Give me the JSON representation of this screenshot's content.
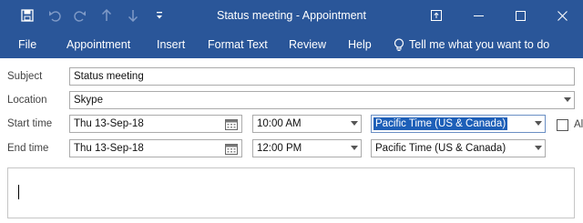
{
  "window": {
    "title": "Status meeting  -  Appointment"
  },
  "quick_access": {
    "icons": [
      "save-icon",
      "undo-icon",
      "redo-icon",
      "move-up-icon",
      "move-down-icon",
      "customize-icon"
    ]
  },
  "window_controls": [
    "ribbon-display-options-icon",
    "minimize-icon",
    "restore-icon",
    "close-icon"
  ],
  "ribbon": {
    "tabs": [
      "File",
      "Appointment",
      "Insert",
      "Format Text",
      "Review",
      "Help"
    ],
    "tell_me": "Tell me what you want to do"
  },
  "form": {
    "subject": {
      "label": "Subject",
      "value": "Status meeting"
    },
    "location": {
      "label": "Location",
      "value": "Skype"
    },
    "start": {
      "label": "Start time",
      "date": "Thu 13-Sep-18",
      "time": "10:00 AM",
      "timezone": "Pacific Time (US & Canada)"
    },
    "end": {
      "label": "End time",
      "date": "Thu 13-Sep-18",
      "time": "12:00 PM",
      "timezone": "Pacific Time (US & Canada)"
    },
    "all_day_label": "Al"
  },
  "colors": {
    "titlebar": "#2a5699",
    "selection": "#1d5fb8"
  }
}
